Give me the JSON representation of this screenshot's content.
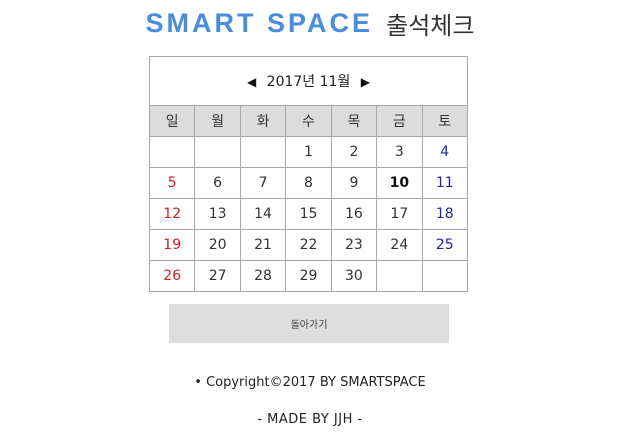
{
  "header": {
    "brand": "SMART SPACE",
    "subtitle": "출석체크"
  },
  "calendar": {
    "prev_icon": "◀",
    "next_icon": "▶",
    "month_label": "2017년 11월",
    "weekdays": [
      "일",
      "월",
      "화",
      "수",
      "목",
      "금",
      "토"
    ],
    "weeks": [
      [
        "",
        "",
        "",
        "1",
        "2",
        "3",
        "4"
      ],
      [
        "5",
        "6",
        "7",
        "8",
        "9",
        "10",
        "11"
      ],
      [
        "12",
        "13",
        "14",
        "15",
        "16",
        "17",
        "18"
      ],
      [
        "19",
        "20",
        "21",
        "22",
        "23",
        "24",
        "25"
      ],
      [
        "26",
        "27",
        "28",
        "29",
        "30",
        "",
        ""
      ]
    ],
    "highlighted_day": "10"
  },
  "actions": {
    "back_label": "돌아가기"
  },
  "footer": {
    "copyright": "• Copyright©2017 BY SMARTSPACE",
    "made_by": "- MADE BY JJH -"
  },
  "colors": {
    "brand": "#4a8ddf",
    "sunday": "#cc2222",
    "saturday": "#2424a8",
    "header_row_bg": "#dcdcdc",
    "button_bg": "#dddddd"
  }
}
